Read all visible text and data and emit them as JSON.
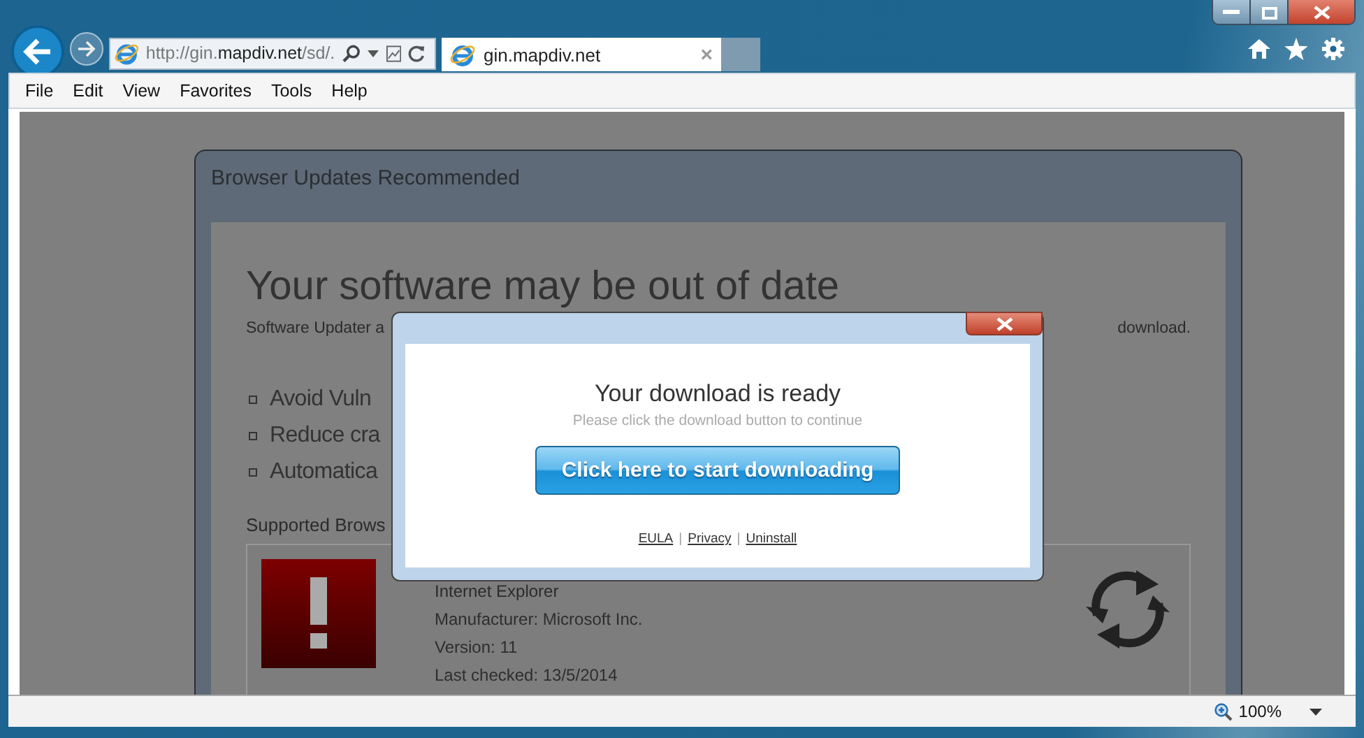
{
  "browser": {
    "address": "http://gin.**mapdiv.net**/sd/.",
    "tab": {
      "title": "gin.mapdiv.net",
      "close": "×",
      "selected": true
    },
    "menu": [
      "File",
      "Edit",
      "View",
      "Favorites",
      "Tools",
      "Help"
    ],
    "status_bar": {
      "zoom": "100%"
    }
  },
  "page": {
    "card_title": "Browser Updates Recommended",
    "heading": "Your software may be out of date",
    "intro_start": "Software Updater a",
    "intro_end": "download.",
    "bullets": [
      "Avoid Vuln",
      "Reduce cra",
      "Automatica"
    ],
    "section_label": "Supported Brows",
    "browser_card": {
      "name": "Internet Explorer",
      "details": [
        "Manufacturer: Microsoft Inc.",
        "Version: 11",
        "Last checked: 13/5/2014"
      ]
    }
  },
  "modal": {
    "title": "Your download is ready",
    "subtitle": "Please click the download button to continue",
    "button": "Click here to start downloading",
    "links": [
      "EULA",
      "Privacy",
      "Uninstall"
    ],
    "separator": "|"
  }
}
